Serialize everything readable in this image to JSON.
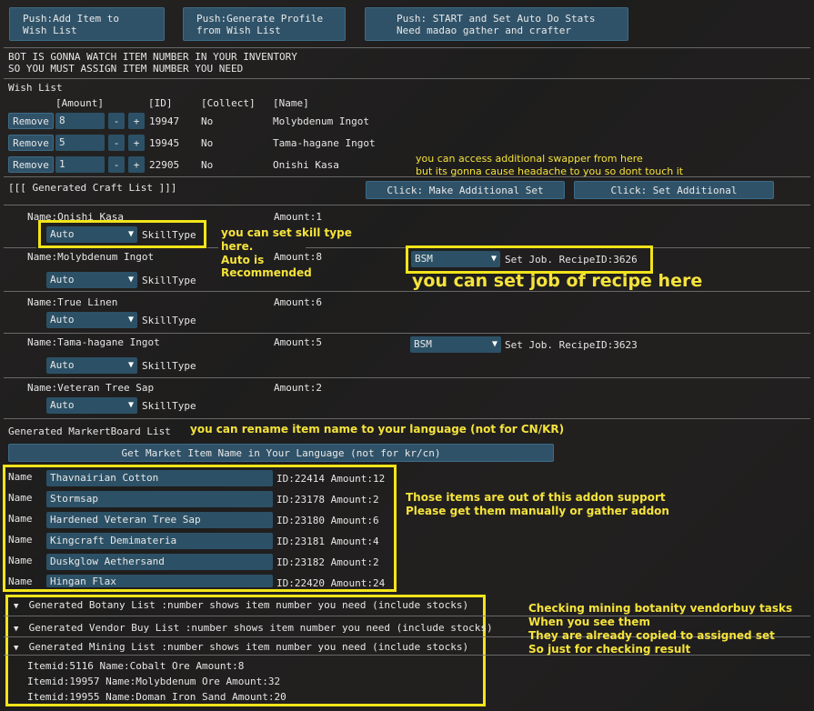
{
  "top_buttons": {
    "add_item": "Push:Add Item to\nWish List",
    "generate_profile": "Push:Generate Profile\nfrom Wish List",
    "start": "Push: START and Set Auto Do Stats\nNeed madao gather and crafter"
  },
  "warning": {
    "line1": "BOT IS GONNA WATCH ITEM NUMBER IN YOUR INVENTORY",
    "line2": " SO YOU MUST ASSIGN ITEM NUMBER YOU NEED"
  },
  "wishlist": {
    "title": "Wish List",
    "headers": {
      "amount": "[Amount]",
      "id": "[ID]",
      "collect": "[Collect]",
      "name": "[Name]"
    },
    "remove_label": "Remove",
    "minus_label": "-",
    "plus_label": "+",
    "rows": [
      {
        "amount": "8",
        "id": "19947",
        "collect": "No",
        "name": "Molybdenum Ingot"
      },
      {
        "amount": "5",
        "id": "19945",
        "collect": "No",
        "name": "Tama-hagane Ingot"
      },
      {
        "amount": "1",
        "id": "22905",
        "collect": "No",
        "name": "Onishi Kasa"
      }
    ]
  },
  "annotations": {
    "swapper_1": "you can access additional swapper from here",
    "swapper_2": "but its gonna cause headache to you so dont touch it",
    "skill_1": "you can set skill type",
    "skill_2": "here.",
    "skill_3": "Auto is",
    "skill_4": "Recommended",
    "job": "you can set job of recipe here",
    "rename": "you can rename item name to your language (not for CN/KR)",
    "unsupported_1": "Those items are out of this addon support",
    "unsupported_2": "Please get them manually or gather addon",
    "check_1": "Checking mining botanity vendorbuy tasks",
    "check_2": "When you see them",
    "check_3": "They are already copied to assigned set",
    "check_4": "So just for checking result"
  },
  "craft": {
    "title": "[[[ Generated Craft List ]]]",
    "make_additional": "Click: Make Additional Set",
    "set_additional": "Click: Set Additional",
    "skilltype_label": "SkillType",
    "setjob_prefix": "Set Job. RecipeID:",
    "items": [
      {
        "name": "Name:Onishi Kasa",
        "amount": "Amount:1",
        "skill": "Auto"
      },
      {
        "name": "Name:Molybdenum Ingot",
        "amount": "Amount:8",
        "skill": "Auto",
        "job": "BSM",
        "recipe": "Set Job. RecipeID:3626"
      },
      {
        "name": "Name:True Linen",
        "amount": "Amount:6",
        "skill": "Auto"
      },
      {
        "name": "Name:Tama-hagane Ingot",
        "amount": "Amount:5",
        "skill": "Auto",
        "job": "BSM",
        "recipe": "Set Job. RecipeID:3623"
      },
      {
        "name": "Name:Veteran Tree Sap",
        "amount": "Amount:2",
        "skill": "Auto"
      }
    ]
  },
  "market": {
    "title": "Generated MarkertBoard List",
    "get_names_button": "Get Market Item Name in Your Language (not for kr/cn)",
    "name_label": "Name",
    "items": [
      {
        "name": "Thavnairian Cotton",
        "info": "ID:22414 Amount:12"
      },
      {
        "name": "Stormsap",
        "info": "ID:23178 Amount:2"
      },
      {
        "name": "Hardened Veteran Tree Sap",
        "info": "ID:23180 Amount:6"
      },
      {
        "name": "Kingcraft Demimateria",
        "info": "ID:23181 Amount:4"
      },
      {
        "name": "Duskglow Aethersand",
        "info": "ID:23182 Amount:2"
      },
      {
        "name": "Hingan Flax",
        "info": "ID:22420 Amount:24"
      }
    ]
  },
  "gather": {
    "botany": "Generated Botany List  :number shows item number you need (include stocks)",
    "vendor": "Generated Vendor Buy List  :number shows item number you need (include stocks)",
    "mining": "Generated Mining List  :number shows item number you need (include stocks)",
    "mining_items": [
      "Itemid:5116 Name:Cobalt Ore Amount:8",
      "Itemid:19957 Name:Molybdenum Ore Amount:32",
      "Itemid:19955 Name:Doman Iron Sand Amount:20"
    ]
  },
  "colors": {
    "highlight": "#f2e41a",
    "button": "#2f5268",
    "annotation": "#f5e33c"
  }
}
